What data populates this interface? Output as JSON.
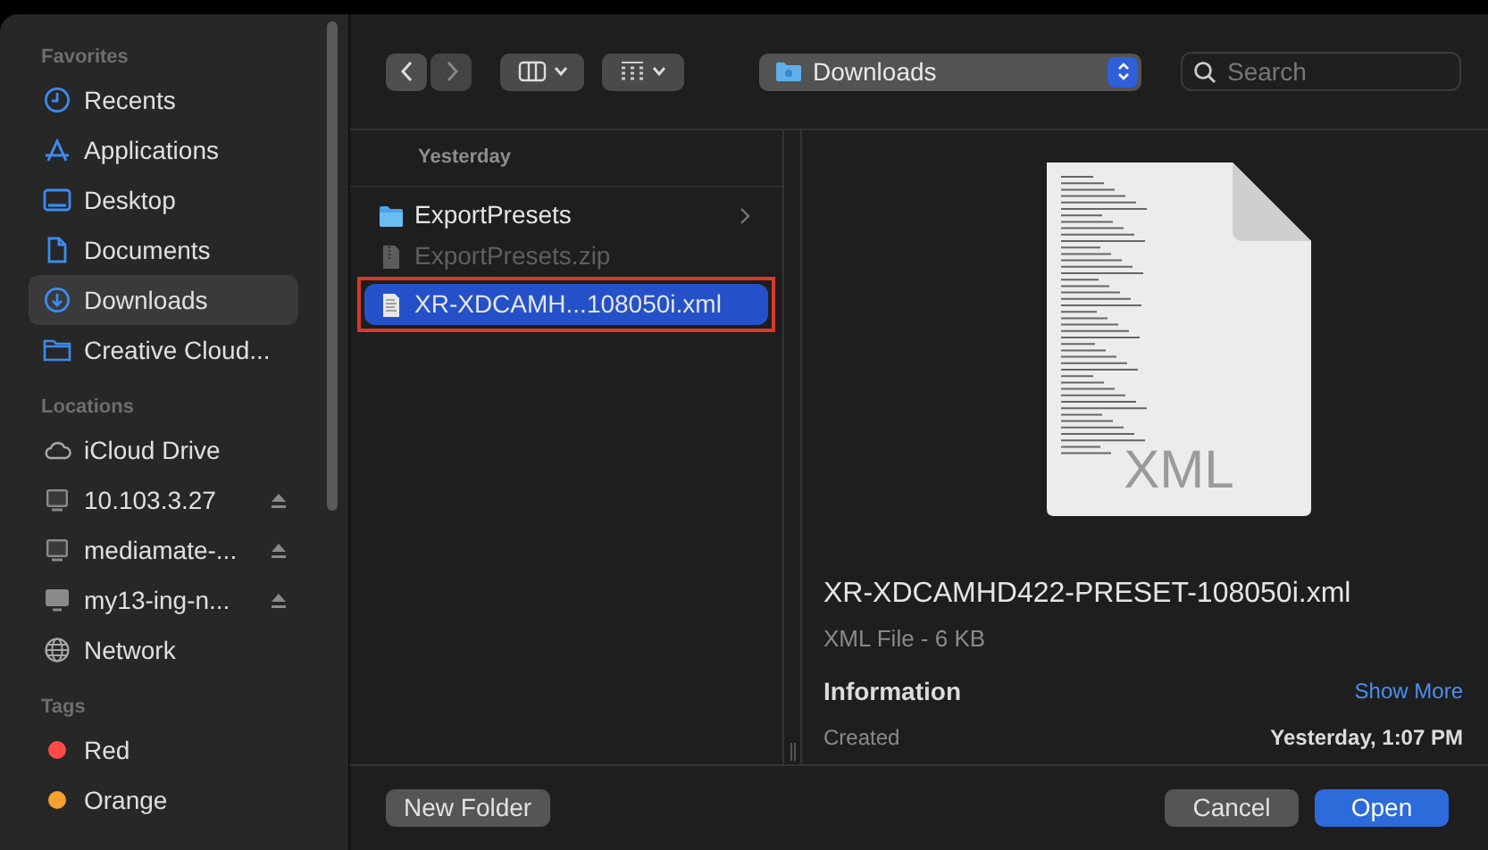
{
  "sidebar": {
    "sections": [
      {
        "heading": "Favorites",
        "items": [
          {
            "label": "Recents",
            "kind": "clock",
            "selected": false
          },
          {
            "label": "Applications",
            "kind": "apps",
            "selected": false
          },
          {
            "label": "Desktop",
            "kind": "desktop",
            "selected": false
          },
          {
            "label": "Documents",
            "kind": "document",
            "selected": false
          },
          {
            "label": "Downloads",
            "kind": "download",
            "selected": true
          },
          {
            "label": "Creative Cloud...",
            "kind": "folder",
            "selected": false
          }
        ]
      },
      {
        "heading": "Locations",
        "items": [
          {
            "label": "iCloud Drive",
            "kind": "cloud",
            "selected": false,
            "ejectable": false
          },
          {
            "label": "10.103.3.27",
            "kind": "server",
            "selected": false,
            "ejectable": true
          },
          {
            "label": "mediamate-...",
            "kind": "server",
            "selected": false,
            "ejectable": true
          },
          {
            "label": "my13-ing-n...",
            "kind": "computer",
            "selected": false,
            "ejectable": true
          },
          {
            "label": "Network",
            "kind": "network",
            "selected": false,
            "ejectable": false
          }
        ]
      },
      {
        "heading": "Tags",
        "items": [
          {
            "label": "Red",
            "kind": "tag",
            "selected": false,
            "color": "#fe4a49"
          },
          {
            "label": "Orange",
            "kind": "tag",
            "selected": false,
            "color": "#f6a030"
          }
        ]
      }
    ]
  },
  "toolbar": {
    "location": "Downloads",
    "search": {
      "placeholder": "Search"
    }
  },
  "file_list": {
    "group": "Yesterday",
    "items": [
      {
        "name": "ExportPresets",
        "kind": "folder",
        "selected": false,
        "disabled": false,
        "outlined": false
      },
      {
        "name": "ExportPresets.zip",
        "kind": "archive",
        "selected": false,
        "disabled": true,
        "outlined": false
      },
      {
        "name": "XR-XDCAMH...108050i.xml",
        "kind": "xml",
        "selected": true,
        "disabled": false,
        "outlined": true
      }
    ]
  },
  "preview": {
    "icon_label": "XML",
    "title": "XR-XDCAMHD422-PRESET-108050i.xml",
    "subtitle": "XML File - 6 KB",
    "info_heading": "Information",
    "show_more": "Show More",
    "rows": [
      {
        "label": "Created",
        "value": "Yesterday, 1:07 PM"
      }
    ]
  },
  "buttons": {
    "new_folder": "New Folder",
    "cancel": "Cancel",
    "open": "Open"
  }
}
